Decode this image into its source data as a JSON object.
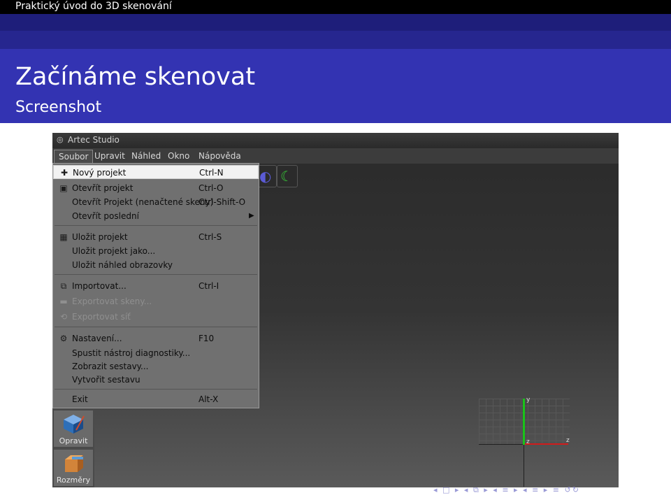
{
  "header": {
    "presentation_title": "Praktický úvod do 3D skenování",
    "frame_title": "Začínáme skenovat",
    "frame_subtitle": "Screenshot"
  },
  "app": {
    "window_title": "Artec Studio",
    "menubar": [
      "Soubor",
      "Upravit",
      "Náhled",
      "Okno",
      "Nápověda"
    ],
    "active_menu": "Soubor",
    "file_menu": {
      "new_project": {
        "label": "Nový projekt",
        "shortcut": "Ctrl-N"
      },
      "open_project": {
        "label": "Otevřít projekt",
        "shortcut": "Ctrl-O"
      },
      "open_project_unloaded": {
        "label": "Otevřít Projekt (nenačtené skeny)",
        "shortcut": "Ctrl-Shift-O"
      },
      "open_recent": {
        "label": "Otevřít poslední",
        "shortcut": ""
      },
      "save_project": {
        "label": "Uložit projekt",
        "shortcut": "Ctrl-S"
      },
      "save_project_as": {
        "label": "Uložit projekt jako...",
        "shortcut": ""
      },
      "save_screenshot": {
        "label": "Uložit náhled obrazovky",
        "shortcut": ""
      },
      "import": {
        "label": "Importovat...",
        "shortcut": "Ctrl-I"
      },
      "export_scans": {
        "label": "Exportovat skeny...",
        "shortcut": ""
      },
      "export_mesh": {
        "label": "Exportovat síť",
        "shortcut": ""
      },
      "settings": {
        "label": "Nastavení...",
        "shortcut": "F10"
      },
      "diagnostics": {
        "label": "Spustit nástroj diagnostiky...",
        "shortcut": ""
      },
      "show_reports": {
        "label": "Zobrazit sestavy...",
        "shortcut": ""
      },
      "create_report": {
        "label": "Vytvořit sestavu",
        "shortcut": ""
      },
      "exit": {
        "label": "Exit",
        "shortcut": "Alt-X"
      }
    },
    "side_panel": {
      "edit_label": "Opravit",
      "measure_label": "Rozměry"
    },
    "axes": {
      "y": "y",
      "z": "z",
      "x": "z"
    }
  },
  "colors": {
    "beamer_blue": "#3333b2",
    "axis_green": "#19c419",
    "axis_red": "#d21b1b"
  }
}
